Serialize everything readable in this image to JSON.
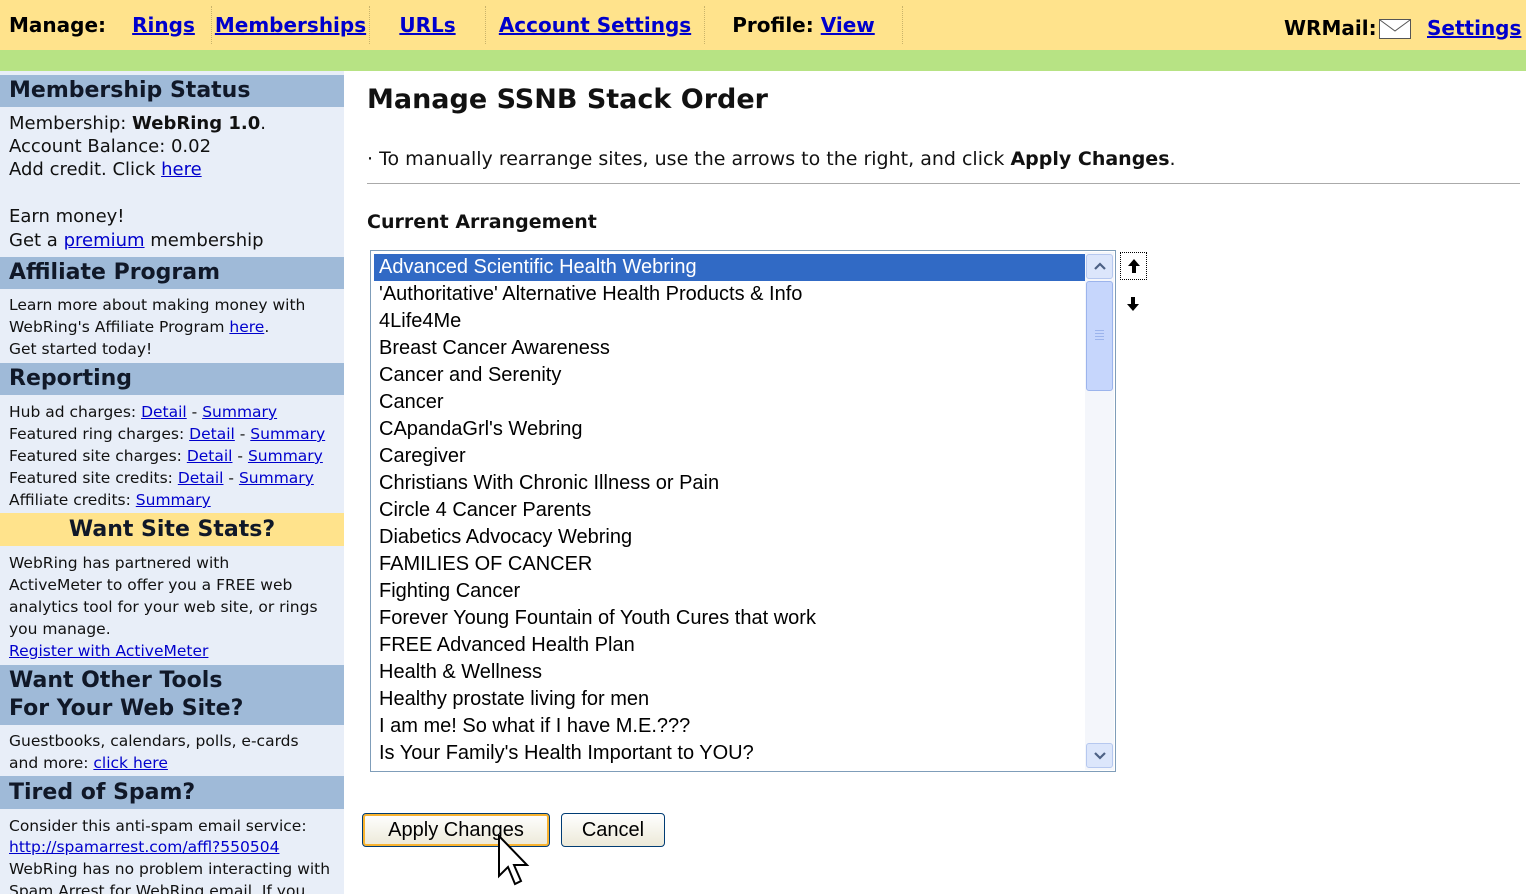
{
  "nav": {
    "manage_label": "Manage:",
    "tabs": [
      {
        "label": "Rings"
      },
      {
        "label": "Memberships"
      },
      {
        "label": "URLs"
      },
      {
        "label": "Account Settings"
      }
    ],
    "profile_label": "Profile:",
    "profile_link": "View",
    "wrmail_label": "WRMail:",
    "mail_icon": "envelope-icon",
    "settings_link": "Settings"
  },
  "sidebar": {
    "membership_status": {
      "heading": "Membership Status",
      "membership_prefix": "Membership: ",
      "membership_value": "WebRing 1.0",
      "membership_suffix": ".",
      "balance": "Account Balance: 0.02",
      "credit_text": "Add credit. Click ",
      "credit_link": "here",
      "earn": "Earn money!",
      "premium_pre": "Get a ",
      "premium_link": "premium",
      "premium_post": " membership"
    },
    "affiliate": {
      "heading": "Affiliate Program",
      "line1": "Learn more about making money with",
      "line2_pre": "WebRing's Affiliate Program ",
      "line2_link": "here",
      "line2_post": ".",
      "line3": "Get started today!"
    },
    "reporting": {
      "heading": "Reporting",
      "rows": [
        {
          "label": "Hub ad charges: ",
          "detail": "Detail",
          "sep": " - ",
          "summary": "Summary"
        },
        {
          "label": "Featured ring charges: ",
          "detail": "Detail",
          "sep": " - ",
          "summary": "Summary"
        },
        {
          "label": "Featured site charges: ",
          "detail": "Detail",
          "sep": " - ",
          "summary": "Summary"
        },
        {
          "label": "Featured site credits: ",
          "detail": "Detail",
          "sep": " - ",
          "summary": "Summary"
        }
      ],
      "affiliate_credits_label": "Affiliate credits: ",
      "affiliate_credits_link": "Summary"
    },
    "site_stats": {
      "heading": "Want Site Stats?",
      "line1": "WebRing has partnered with",
      "line2": "ActiveMeter to offer you a FREE web",
      "line3": "analytics tool for your web site, or rings",
      "line4": "you manage.",
      "link": "Register with ActiveMeter"
    },
    "other_tools": {
      "heading_line1": "Want Other Tools",
      "heading_line2": "For Your Web Site?",
      "line1": "Guestbooks, calendars, polls, e-cards",
      "line2_pre": "and more: ",
      "line2_link": "click here"
    },
    "spam": {
      "heading": "Tired of Spam?",
      "line1": "Consider this anti-spam email service:",
      "link": "http://spamarrest.com/affl?550504",
      "line2": "WebRing has no problem interacting with",
      "line3": "Spam Arrest for WebRing email. If you"
    }
  },
  "main": {
    "title": "Manage SSNB Stack Order",
    "instruction_pre": "· To manually rearrange sites, use the arrows to the right, and click ",
    "instruction_bold": "Apply Changes",
    "instruction_post": ".",
    "current_label": "Current Arrangement",
    "items": [
      "Advanced Scientific Health Webring",
      "'Authoritative' Alternative Health Products & Info",
      "4Life4Me",
      "Breast Cancer Awareness",
      "Cancer and Serenity",
      "Cancer",
      "CApandaGrl's Webring",
      "Caregiver",
      "Christians With Chronic Illness or Pain",
      "Circle 4 Cancer Parents",
      "Diabetics Advocacy Webring",
      "FAMILIES OF CANCER",
      "Fighting Cancer",
      "Forever Young Fountain of Youth Cures that work",
      "FREE Advanced Health Plan",
      "Health & Wellness",
      "Healthy prostate living for men",
      "I am me! So what if I have M.E.???",
      "Is Your Family's Health Important to YOU?"
    ],
    "selected_index": 0,
    "apply_label": "Apply Changes",
    "cancel_label": "Cancel"
  },
  "colors": {
    "nav_bg": "#ffe38c",
    "green_bar": "#b7e384",
    "sidebar_bg": "#e8eef8",
    "sidebar_head": "#9fbad8",
    "selection": "#316ac5",
    "link": "#0000cc"
  }
}
